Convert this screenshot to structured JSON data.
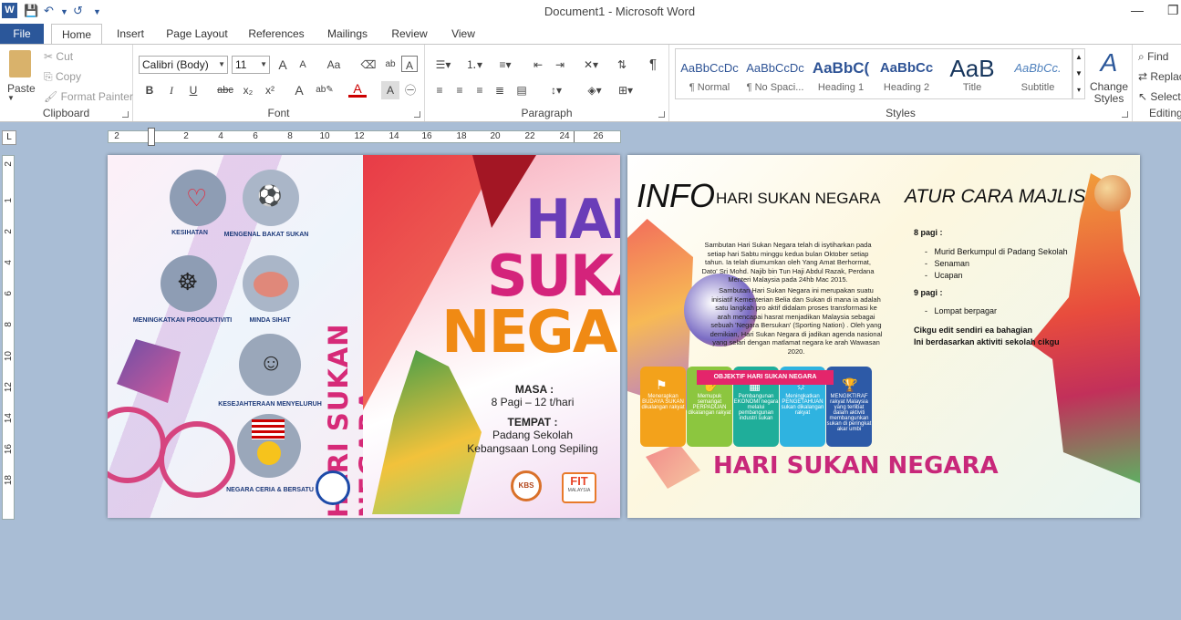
{
  "app": {
    "title": "Document1 - Microsoft Word",
    "logo": "W"
  },
  "quick_access": {
    "save_icon": "save-icon",
    "undo_icon": "undo-icon",
    "redo_icon": "redo-icon",
    "customize_icon": "customize-icon"
  },
  "window": {
    "minimize": "—",
    "restore": "❐"
  },
  "tabs": [
    "File",
    "Home",
    "Insert",
    "Page Layout",
    "References",
    "Mailings",
    "Review",
    "View"
  ],
  "ribbon": {
    "clipboard": {
      "label": "Clipboard",
      "paste": "Paste",
      "cut": "Cut",
      "copy": "Copy",
      "format_painter": "Format Painter"
    },
    "font": {
      "label": "Font",
      "name": "Calibri (Body)",
      "size": "11",
      "grow": "A",
      "shrink": "A",
      "case": "Aa",
      "bold": "B",
      "italic": "I",
      "underline": "U",
      "strike": "abc",
      "sub": "x₂",
      "sup": "x²"
    },
    "paragraph": {
      "label": "Paragraph",
      "pilcrow": "¶"
    },
    "styles": {
      "label": "Styles",
      "items": [
        {
          "preview": "AaBbCcDc",
          "name": "¶ Normal"
        },
        {
          "preview": "AaBbCcDc",
          "name": "¶ No Spaci..."
        },
        {
          "preview": "AaBbC(",
          "name": "Heading 1"
        },
        {
          "preview": "AaBbCc",
          "name": "Heading 2"
        },
        {
          "preview": "AaB",
          "name": "Title"
        },
        {
          "preview": "AaBbCc.",
          "name": "Subtitle"
        }
      ],
      "change_styles": "Change Styles"
    },
    "editing": {
      "label": "Editing",
      "find": "Find",
      "replace": "Replace",
      "select": "Select"
    }
  },
  "ruler": {
    "tab_button": "L",
    "h_numbers": [
      "2",
      "2",
      "4",
      "6",
      "8",
      "10",
      "12",
      "14",
      "16",
      "18",
      "20",
      "22",
      "24",
      "26"
    ],
    "v_numbers": [
      "2",
      "1",
      "2",
      "4",
      "6",
      "8",
      "10",
      "12",
      "14",
      "16",
      "18"
    ]
  },
  "page1": {
    "labels": [
      "KESIHATAN",
      "MENGENAL BAKAT SUKAN",
      "MENINGKATKAN PRODUKTIVITI",
      "MINDA SIHAT",
      "KESEJAHTERAAN MENYELURUH",
      "NEGARA CERIA & BERSATU"
    ],
    "vertical_title": "HARI SUKAN NEGARA",
    "hari": "HARI",
    "sukan": "SUKAN",
    "negara": "NEGARA",
    "masa_label": "MASA :",
    "masa_value": "8 Pagi – 12 t/hari",
    "tempat_label": "TEMPAT :",
    "tempat_line1": "Padang Sekolah",
    "tempat_line2": "Kebangsaan Long Sepiling",
    "logo_kbs": "KBS",
    "logo_fit": "FIT",
    "logo_fit_sub": "MALAYSIA"
  },
  "page2": {
    "info_big": "INFO",
    "info_title": "HARI SUKAN NEGARA",
    "para1": "Sambutan Hari Sukan Negara telah di isytiharkan pada setiap hari Sabtu minggu kedua bulan Oktober setiap tahun. Ia telah diumumkan oleh Yang Amat Berhormat, Dato' Sri Mohd. Najib bin Tun Haji Abdul Razak, Perdana Menteri Malaysia pada 24hb Mac 2015.",
    "para2": "Sambutan Hari Sukan Negara ini merupakan suatu inisiatif Kementerian Belia dan Sukan di mana ia adalah satu langkah pro aktif didalam proses transformasi ke arah mencapai hasrat menjadikan Malaysia sebagai sebuah 'Negara Bersukan' (Sporting Nation) . Oleh yang demikian, Hari Sukan Negara di jadikan agenda nasional yang selari dengan matlamat negara ke arah Wawasan 2020.",
    "objektif_title": "OBJEKTIF HARI SUKAN NEGARA",
    "objectives": [
      "Menerapkan BUDAYA SUKAN dikalangan rakyat",
      "Memupuk semangat PERPADUAN dikalangan rakyat",
      "Pembangunan EKONOMI negara melalui pembangunan industri sukan",
      "Meningkatkan PENGETAHUAN sukan dikalangan rakyat",
      "MENGIKTIRAF rakyat Malaysia yang terlibat dalam aktiviti membangunkan sukan di peringkat akar umbi"
    ],
    "bottom_title": "HARI SUKAN NEGARA",
    "atur_title": "ATUR CARA MAJLIS",
    "time1": "8 pagi :",
    "items1": [
      "Murid Berkumpul di Padang Sekolah",
      "Senaman",
      "Ucapan"
    ],
    "time2": "9 pagi :",
    "items2": [
      "Lompat berpagar"
    ],
    "note1": "Cikgu edit sendiri ea bahagian",
    "note2": "Ini berdasarkan aktiviti sekolah cikgu"
  }
}
